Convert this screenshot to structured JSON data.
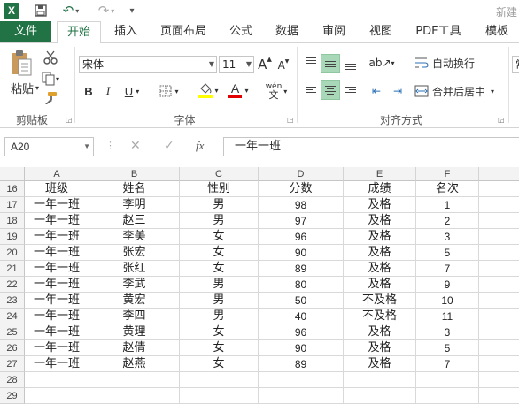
{
  "titlebar": {
    "logo": "X",
    "document_title": "新建"
  },
  "tabs": [
    {
      "label": "文件",
      "kind": "file"
    },
    {
      "label": "开始",
      "kind": "active"
    },
    {
      "label": "插入"
    },
    {
      "label": "页面布局"
    },
    {
      "label": "公式"
    },
    {
      "label": "数据"
    },
    {
      "label": "审阅"
    },
    {
      "label": "视图"
    },
    {
      "label": "PDF工具"
    },
    {
      "label": "模板"
    }
  ],
  "ribbon": {
    "clipboard": {
      "paste_label": "粘贴",
      "group_label": "剪贴板"
    },
    "font": {
      "family": "宋体",
      "size": "11",
      "group_label": "字体",
      "bold": "B",
      "italic": "I",
      "underline": "U",
      "grow": "A",
      "shrink": "A",
      "font_color_glyph": "A",
      "wen": "wén"
    },
    "alignment": {
      "wrap_label": "自动换行",
      "merge_label": "合并后居中",
      "group_label": "对齐方式"
    },
    "next_combo": "常"
  },
  "formula_bar": {
    "name_box": "A20",
    "fx": "fx",
    "formula": "一年一班"
  },
  "columns": [
    "A",
    "B",
    "C",
    "D",
    "E",
    "F"
  ],
  "rows": [
    {
      "n": "16",
      "cells": [
        "班级",
        "姓名",
        "性别",
        "分数",
        "成绩",
        "名次"
      ]
    },
    {
      "n": "17",
      "cells": [
        "一年一班",
        "李明",
        "男",
        "98",
        "及格",
        "1"
      ]
    },
    {
      "n": "18",
      "cells": [
        "一年一班",
        "赵三",
        "男",
        "97",
        "及格",
        "2"
      ]
    },
    {
      "n": "19",
      "cells": [
        "一年一班",
        "李美",
        "女",
        "96",
        "及格",
        "3"
      ]
    },
    {
      "n": "20",
      "cells": [
        "一年一班",
        "张宏",
        "女",
        "90",
        "及格",
        "5"
      ]
    },
    {
      "n": "21",
      "cells": [
        "一年一班",
        "张红",
        "女",
        "89",
        "及格",
        "7"
      ]
    },
    {
      "n": "22",
      "cells": [
        "一年一班",
        "李武",
        "男",
        "80",
        "及格",
        "9"
      ]
    },
    {
      "n": "23",
      "cells": [
        "一年一班",
        "黄宏",
        "男",
        "50",
        "不及格",
        "10"
      ]
    },
    {
      "n": "24",
      "cells": [
        "一年一班",
        "李四",
        "男",
        "40",
        "不及格",
        "11"
      ]
    },
    {
      "n": "25",
      "cells": [
        "一年一班",
        "黄理",
        "女",
        "96",
        "及格",
        "3"
      ]
    },
    {
      "n": "26",
      "cells": [
        "一年一班",
        "赵倩",
        "女",
        "90",
        "及格",
        "5"
      ]
    },
    {
      "n": "27",
      "cells": [
        "一年一班",
        "赵燕",
        "女",
        "89",
        "及格",
        "7"
      ]
    },
    {
      "n": "28",
      "cells": [
        "",
        "",
        "",
        "",
        "",
        ""
      ]
    },
    {
      "n": "29",
      "cells": [
        "",
        "",
        "",
        "",
        "",
        ""
      ]
    }
  ],
  "colors": {
    "accent": "#217346",
    "highlight": "#a9d8b8",
    "fill_yellow": "#ffff00",
    "font_red": "#e00000"
  }
}
